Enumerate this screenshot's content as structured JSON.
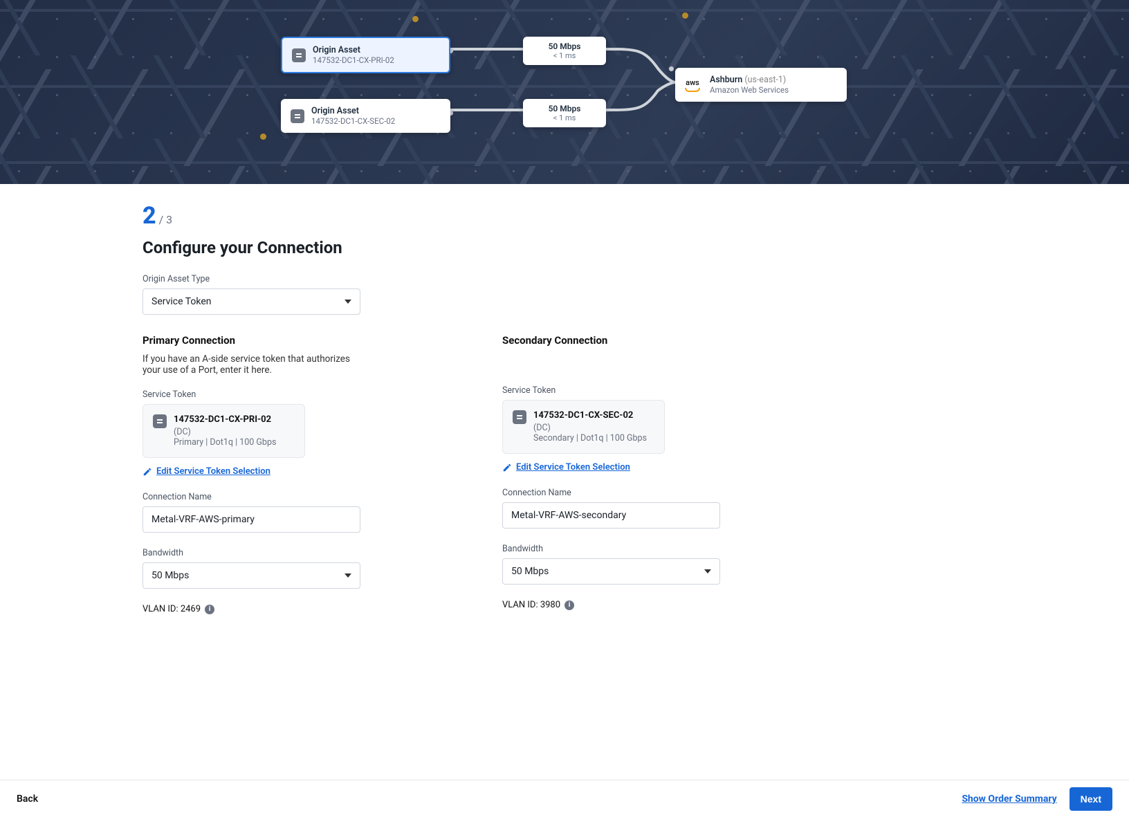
{
  "hero": {
    "primary": {
      "title": "Origin Asset",
      "id": "147532-DC1-CX-PRI-02",
      "speed": "50 Mbps",
      "latency": "< 1 ms"
    },
    "secondary": {
      "title": "Origin Asset",
      "id": "147532-DC1-CX-SEC-02",
      "speed": "50 Mbps",
      "latency": "< 1 ms"
    },
    "dest": {
      "name": "Ashburn",
      "region": "(us-east-1)",
      "provider": "Amazon Web Services",
      "icon": "aws"
    }
  },
  "step": {
    "current": "2",
    "total": "/ 3"
  },
  "title": "Configure your Connection",
  "origin_type": {
    "label": "Origin Asset Type",
    "value": "Service Token"
  },
  "primary": {
    "heading": "Primary Connection",
    "hint": "If you have an A-side service token that authorizes your use of a Port, enter it here.",
    "token_label": "Service Token",
    "token": {
      "name": "147532-DC1-CX-PRI-02",
      "loc": "(DC)",
      "details": "Primary | Dot1q | 100 Gbps"
    },
    "edit": "Edit Service Token Selection",
    "conn_label": "Connection Name",
    "conn_value": "Metal-VRF-AWS-primary",
    "bw_label": "Bandwidth",
    "bw_value": "50 Mbps",
    "vlan": "VLAN ID: 2469"
  },
  "secondary": {
    "heading": "Secondary Connection",
    "token_label": "Service Token",
    "token": {
      "name": "147532-DC1-CX-SEC-02",
      "loc": "(DC)",
      "details": "Secondary | Dot1q | 100 Gbps"
    },
    "edit": "Edit Service Token Selection",
    "conn_label": "Connection Name",
    "conn_value": "Metal-VRF-AWS-secondary",
    "bw_label": "Bandwidth",
    "bw_value": "50 Mbps",
    "vlan": "VLAN ID: 3980"
  },
  "footer": {
    "back": "Back",
    "summary": "Show Order Summary",
    "next": "Next"
  }
}
